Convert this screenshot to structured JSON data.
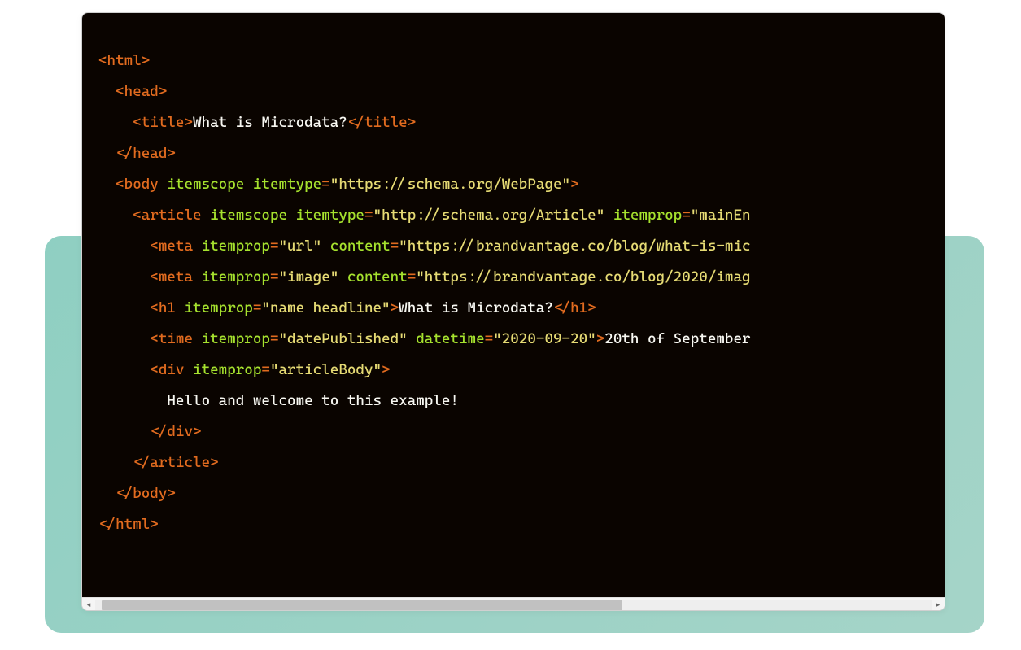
{
  "colors": {
    "bg": "#0a0400",
    "tag": "#e16b1f",
    "attr": "#a6e22e",
    "string": "#e6db74",
    "text": "#f8f8f2",
    "backdrop": "#8fcfc2"
  },
  "code": {
    "lines": [
      {
        "indent": 0,
        "segments": [
          {
            "t": "tag",
            "v": "<html>"
          }
        ]
      },
      {
        "indent": 1,
        "segments": [
          {
            "t": "tag",
            "v": "<head>"
          }
        ]
      },
      {
        "indent": 2,
        "segments": [
          {
            "t": "tag",
            "v": "<title>"
          },
          {
            "t": "txt",
            "v": "What is Microdata?"
          },
          {
            "t": "tag",
            "v": "</title>"
          }
        ]
      },
      {
        "indent": 1,
        "segments": [
          {
            "t": "tag",
            "v": "</head>"
          }
        ]
      },
      {
        "indent": 1,
        "segments": [
          {
            "t": "tag",
            "v": "<body "
          },
          {
            "t": "attr",
            "v": "itemscope itemtype"
          },
          {
            "t": "op",
            "v": "="
          },
          {
            "t": "str",
            "v": "\"https://schema.org/WebPage\""
          },
          {
            "t": "tag",
            "v": ">"
          }
        ]
      },
      {
        "indent": 2,
        "segments": [
          {
            "t": "tag",
            "v": "<article "
          },
          {
            "t": "attr",
            "v": "itemscope itemtype"
          },
          {
            "t": "op",
            "v": "="
          },
          {
            "t": "str",
            "v": "\"http://schema.org/Article\""
          },
          {
            "t": "txt",
            "v": " "
          },
          {
            "t": "attr",
            "v": "itemprop"
          },
          {
            "t": "op",
            "v": "="
          },
          {
            "t": "str",
            "v": "\"mainEn"
          }
        ]
      },
      {
        "indent": 3,
        "segments": [
          {
            "t": "tag",
            "v": "<meta "
          },
          {
            "t": "attr",
            "v": "itemprop"
          },
          {
            "t": "op",
            "v": "="
          },
          {
            "t": "str",
            "v": "\"url\""
          },
          {
            "t": "txt",
            "v": " "
          },
          {
            "t": "attr",
            "v": "content"
          },
          {
            "t": "op",
            "v": "="
          },
          {
            "t": "str",
            "v": "\"https://brandvantage.co/blog/what-is-mic"
          }
        ]
      },
      {
        "indent": 3,
        "segments": [
          {
            "t": "tag",
            "v": "<meta "
          },
          {
            "t": "attr",
            "v": "itemprop"
          },
          {
            "t": "op",
            "v": "="
          },
          {
            "t": "str",
            "v": "\"image\""
          },
          {
            "t": "txt",
            "v": " "
          },
          {
            "t": "attr",
            "v": "content"
          },
          {
            "t": "op",
            "v": "="
          },
          {
            "t": "str",
            "v": "\"https://brandvantage.co/blog/2020/imag"
          }
        ]
      },
      {
        "indent": 3,
        "segments": [
          {
            "t": "tag",
            "v": "<h1 "
          },
          {
            "t": "attr",
            "v": "itemprop"
          },
          {
            "t": "op",
            "v": "="
          },
          {
            "t": "str",
            "v": "\"name headline\""
          },
          {
            "t": "tag",
            "v": ">"
          },
          {
            "t": "txt",
            "v": "What is Microdata?"
          },
          {
            "t": "tag",
            "v": "</h1>"
          }
        ]
      },
      {
        "indent": 3,
        "segments": [
          {
            "t": "tag",
            "v": "<time "
          },
          {
            "t": "attr",
            "v": "itemprop"
          },
          {
            "t": "op",
            "v": "="
          },
          {
            "t": "str",
            "v": "\"datePublished\""
          },
          {
            "t": "txt",
            "v": " "
          },
          {
            "t": "attr",
            "v": "datetime"
          },
          {
            "t": "op",
            "v": "="
          },
          {
            "t": "str",
            "v": "\"2020-09-20\""
          },
          {
            "t": "tag",
            "v": ">"
          },
          {
            "t": "txt",
            "v": "20th of September"
          }
        ]
      },
      {
        "indent": 3,
        "segments": [
          {
            "t": "tag",
            "v": "<div "
          },
          {
            "t": "attr",
            "v": "itemprop"
          },
          {
            "t": "op",
            "v": "="
          },
          {
            "t": "str",
            "v": "\"articleBody\""
          },
          {
            "t": "tag",
            "v": ">"
          }
        ]
      },
      {
        "indent": 4,
        "segments": [
          {
            "t": "txt",
            "v": "Hello and welcome to this example!"
          }
        ]
      },
      {
        "indent": 3,
        "segments": [
          {
            "t": "tag",
            "v": "</div>"
          }
        ]
      },
      {
        "indent": 2,
        "segments": [
          {
            "t": "tag",
            "v": "</article>"
          }
        ]
      },
      {
        "indent": 1,
        "segments": [
          {
            "t": "tag",
            "v": "</body>"
          }
        ]
      },
      {
        "indent": 0,
        "segments": [
          {
            "t": "tag",
            "v": "</html>"
          }
        ]
      }
    ]
  },
  "scrollbar": {
    "left_arrow": "◂",
    "right_arrow": "▸"
  }
}
